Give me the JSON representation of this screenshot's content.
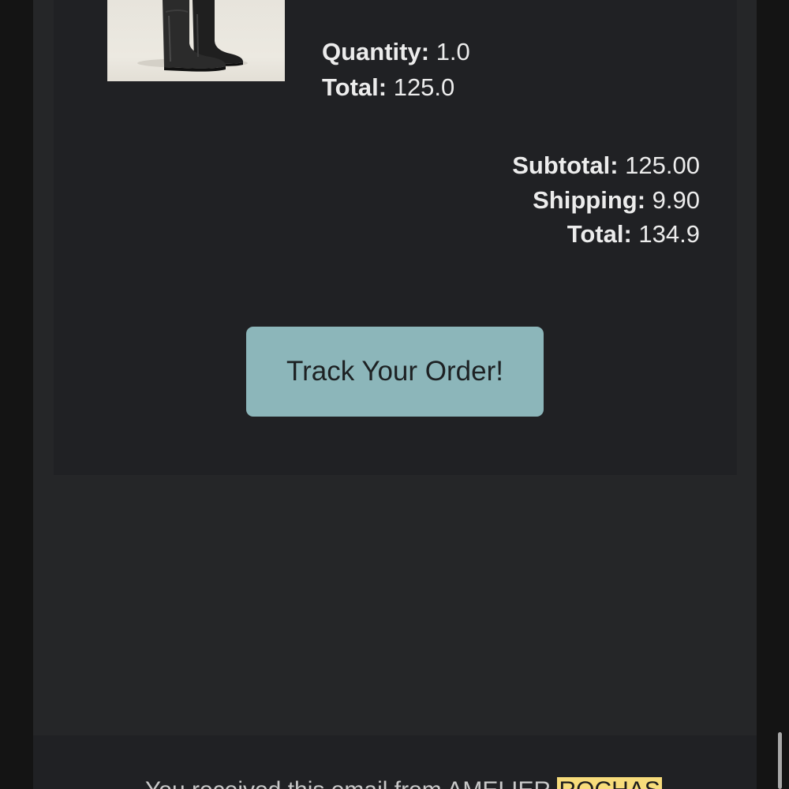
{
  "item": {
    "image_alt": "black leather boots",
    "quantity_label": "Quantity:",
    "quantity_value": "1.0",
    "total_label": "Total:",
    "total_value": "125.0"
  },
  "summary": {
    "subtotal_label": "Subtotal:",
    "subtotal_value": "125.00",
    "shipping_label": "Shipping:",
    "shipping_value": "9.90",
    "total_label": "Total:",
    "total_value": "134.9"
  },
  "cta": {
    "label": "Track Your Order!"
  },
  "footer": {
    "text_prefix": "You received this email from AMELIER",
    "brand_highlight": "ROCHAS"
  },
  "colors": {
    "button_bg": "#8cb6ba",
    "highlight": "#f7dc7b"
  }
}
